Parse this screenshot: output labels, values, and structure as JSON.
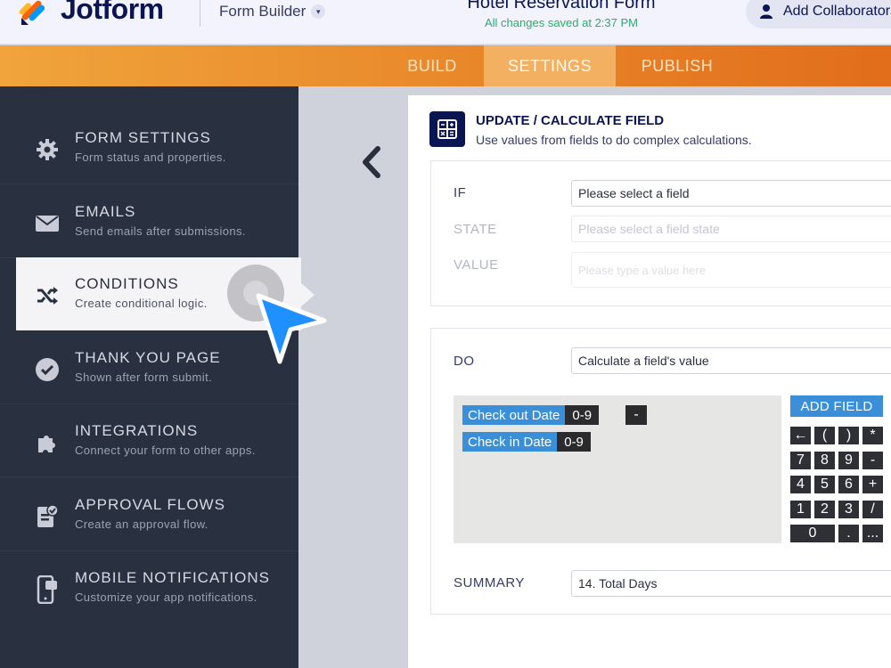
{
  "header": {
    "logo_text": "Jotform",
    "builder_label": "Form Builder",
    "form_title": "Hotel Reservation Form",
    "saved_status": "All changes saved at 2:37 PM",
    "collaborator_label": "Add Collaborators"
  },
  "nav": {
    "tabs": [
      "BUILD",
      "SETTINGS",
      "PUBLISH"
    ],
    "active": "SETTINGS"
  },
  "sidebar": {
    "items": [
      {
        "title": "FORM SETTINGS",
        "subtitle": "Form status and properties.",
        "icon": "gear-icon"
      },
      {
        "title": "EMAILS",
        "subtitle": "Send emails after submissions.",
        "icon": "envelope-icon"
      },
      {
        "title": "CONDITIONS",
        "subtitle": "Create conditional logic.",
        "icon": "shuffle-icon"
      },
      {
        "title": "THANK YOU PAGE",
        "subtitle": "Shown after form submit.",
        "icon": "check-circle-icon"
      },
      {
        "title": "INTEGRATIONS",
        "subtitle": "Connect your form to other apps.",
        "icon": "puzzle-icon"
      },
      {
        "title": "APPROVAL FLOWS",
        "subtitle": "Create an approval flow.",
        "icon": "approval-doc-icon"
      },
      {
        "title": "MOBILE NOTIFICATIONS",
        "subtitle": "Customize your app notifications.",
        "icon": "mobile-icon"
      }
    ],
    "active_index": 2
  },
  "panel": {
    "title": "UPDATE / CALCULATE FIELD",
    "subtitle": "Use values from fields to do complex calculations.",
    "if_label": "IF",
    "if_value": "Please select a field",
    "state_label": "STATE",
    "state_placeholder": "Please select a field state",
    "value_label": "VALUE",
    "value_placeholder": "Please type a value here",
    "do_label": "DO",
    "do_value": "Calculate a field's value",
    "summary_label": "SUMMARY",
    "summary_value": "14. Total Days"
  },
  "calculator": {
    "chips": [
      {
        "name": "Check out Date",
        "range": "0-9"
      },
      {
        "name": "Check in Date",
        "range": "0-9"
      }
    ],
    "operator": "-",
    "add_field_label": "ADD FIELD",
    "keys": [
      [
        "←",
        "(",
        ")",
        "*"
      ],
      [
        "7",
        "8",
        "9",
        "-"
      ],
      [
        "4",
        "5",
        "6",
        "+"
      ],
      [
        "1",
        "2",
        "3",
        "/"
      ],
      [
        "0",
        ".",
        "..."
      ]
    ]
  },
  "colors": {
    "brand_navy": "#0a1551",
    "sidebar_bg": "#293040",
    "nav_orange": "#e8862a",
    "chip_blue": "#3b8fd9",
    "cursor_blue": "#1e90ff"
  }
}
